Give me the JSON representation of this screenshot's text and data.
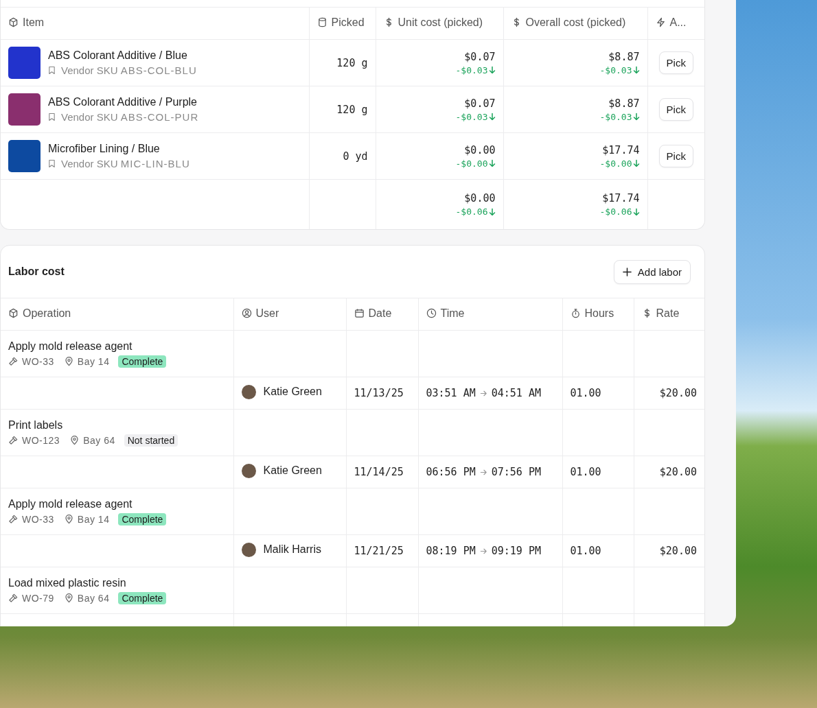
{
  "materials": {
    "columns": [
      "Item",
      "Picked",
      "Unit cost (picked)",
      "Overall cost (picked)",
      "A..."
    ],
    "rows": [
      {
        "name": "ABS Colorant Additive / Blue",
        "sku_label": "Vendor SKU",
        "sku": "ABS-COL-BLU",
        "color": "#2233cc",
        "picked": "120 g",
        "unit": "$0.07",
        "unit_delta": "-$0.03",
        "overall": "$8.87",
        "overall_delta": "-$0.03",
        "action": "Pick"
      },
      {
        "name": "ABS Colorant Additive / Purple",
        "sku_label": "Vendor SKU",
        "sku": "ABS-COL-PUR",
        "color": "#8a2f6e",
        "picked": "120 g",
        "unit": "$0.07",
        "unit_delta": "-$0.03",
        "overall": "$8.87",
        "overall_delta": "-$0.03",
        "action": "Pick"
      },
      {
        "name": "Microfiber Lining / Blue",
        "sku_label": "Vendor SKU",
        "sku": "MIC-LIN-BLU",
        "color": "#0d4aa0",
        "picked": "0 yd",
        "unit": "$0.00",
        "unit_delta": "-$0.00",
        "overall": "$17.74",
        "overall_delta": "-$0.00",
        "action": "Pick"
      }
    ],
    "totals": {
      "unit": "$0.00",
      "unit_delta": "-$0.06",
      "overall": "$17.74",
      "overall_delta": "-$0.06"
    }
  },
  "labor": {
    "title": "Labor cost",
    "add_button": "Add labor",
    "columns": [
      "Operation",
      "User",
      "Date",
      "Time",
      "Hours",
      "Rate"
    ],
    "rows": [
      {
        "kind": "operation",
        "name": "Apply mold release agent",
        "work_order": "WO-33",
        "location": "Bay 14",
        "status": "Complete",
        "complete": true
      },
      {
        "kind": "entry",
        "user": "Katie Green",
        "date": "11/13/25",
        "start": "03:51 AM",
        "end": "04:51 AM",
        "hours": "01.00",
        "rate": "$20.00"
      },
      {
        "kind": "operation",
        "name": "Print labels",
        "work_order": "WO-123",
        "location": "Bay 64",
        "status": "Not started",
        "complete": false
      },
      {
        "kind": "entry",
        "user": "Katie Green",
        "date": "11/14/25",
        "start": "06:56 PM",
        "end": "07:56 PM",
        "hours": "01.00",
        "rate": "$20.00"
      },
      {
        "kind": "operation",
        "name": "Apply mold release agent",
        "work_order": "WO-33",
        "location": "Bay 14",
        "status": "Complete",
        "complete": true
      },
      {
        "kind": "entry",
        "user": "Malik Harris",
        "date": "11/21/25",
        "start": "08:19 PM",
        "end": "09:19 PM",
        "hours": "01.00",
        "rate": "$20.00"
      },
      {
        "kind": "operation",
        "name": "Load mixed plastic resin",
        "work_order": "WO-79",
        "location": "Bay 64",
        "status": "Complete",
        "complete": true
      }
    ]
  }
}
